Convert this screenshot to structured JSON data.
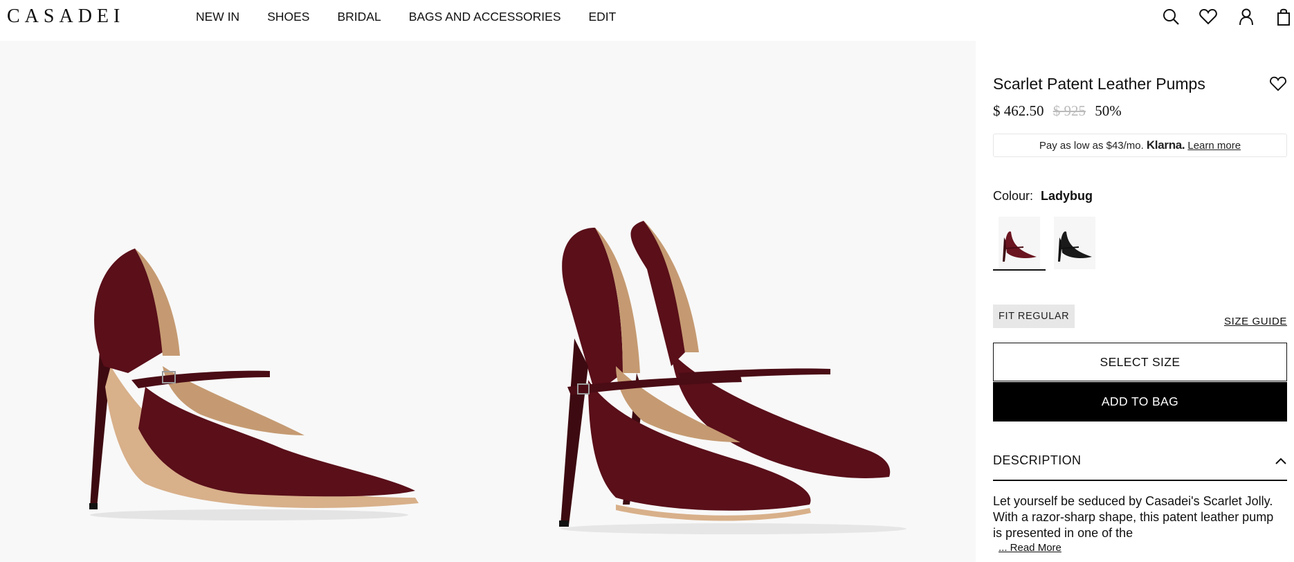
{
  "header": {
    "logo": "CASADEI",
    "nav": [
      "NEW IN",
      "SHOES",
      "BRIDAL",
      "BAGS AND ACCESSORIES",
      "EDIT"
    ],
    "icons": [
      "search-icon",
      "heart-icon",
      "account-icon",
      "bag-icon"
    ]
  },
  "product": {
    "title": "Scarlet Patent Leather Pumps",
    "price_now": "$ 462.50",
    "price_old": "$ 925",
    "discount": "50%",
    "klarna": {
      "text": "Pay as low as $43/mo.",
      "logo": "Klarna.",
      "link": "Learn more"
    },
    "colour_label": "Colour:",
    "colour_value": "Ladybug",
    "swatches": [
      "ladybug",
      "black"
    ],
    "fit": "FIT REGULAR",
    "size_guide": "SIZE GUIDE",
    "select_size": "SELECT SIZE",
    "add_to_bag": "ADD TO BAG",
    "description_label": "DESCRIPTION",
    "description": "Let yourself be seduced by Casadei's Scarlet Jolly. With a razor-sharp shape, this patent leather pump is presented in one of the",
    "read_more": "... Read More"
  },
  "colors": {
    "shoe": "#5a0f19",
    "lining": "#c59a72",
    "gallery_bg": "#f8f8f8"
  }
}
